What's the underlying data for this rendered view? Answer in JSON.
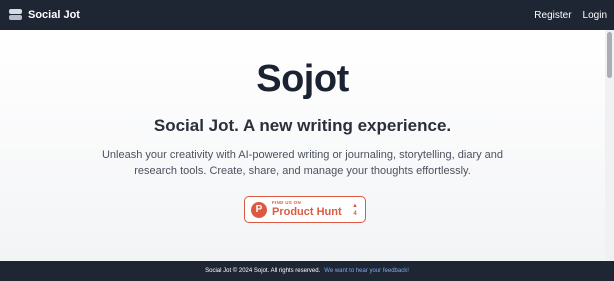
{
  "navbar": {
    "brand": "Social Jot",
    "register_label": "Register",
    "login_label": "Login"
  },
  "hero": {
    "title": "Sojot",
    "subtitle": "Social Jot. A new writing experience.",
    "description": "Unleash your creativity with AI-powered writing or journaling, storytelling, diary and research tools. Create, share, and manage your thoughts effortlessly."
  },
  "product_hunt": {
    "logo_letter": "P",
    "small_text": "FIND US ON",
    "name": "Product Hunt",
    "arrow": "▲",
    "votes": "4",
    "color": "#dc5a42"
  },
  "footer": {
    "copyright": "Social Jot © 2024 Sojot. All rights reserved.",
    "feedback_link": "We want to hear your feedback!"
  },
  "colors": {
    "nav_bg": "#1e2533",
    "link": "#7fa8ea"
  }
}
